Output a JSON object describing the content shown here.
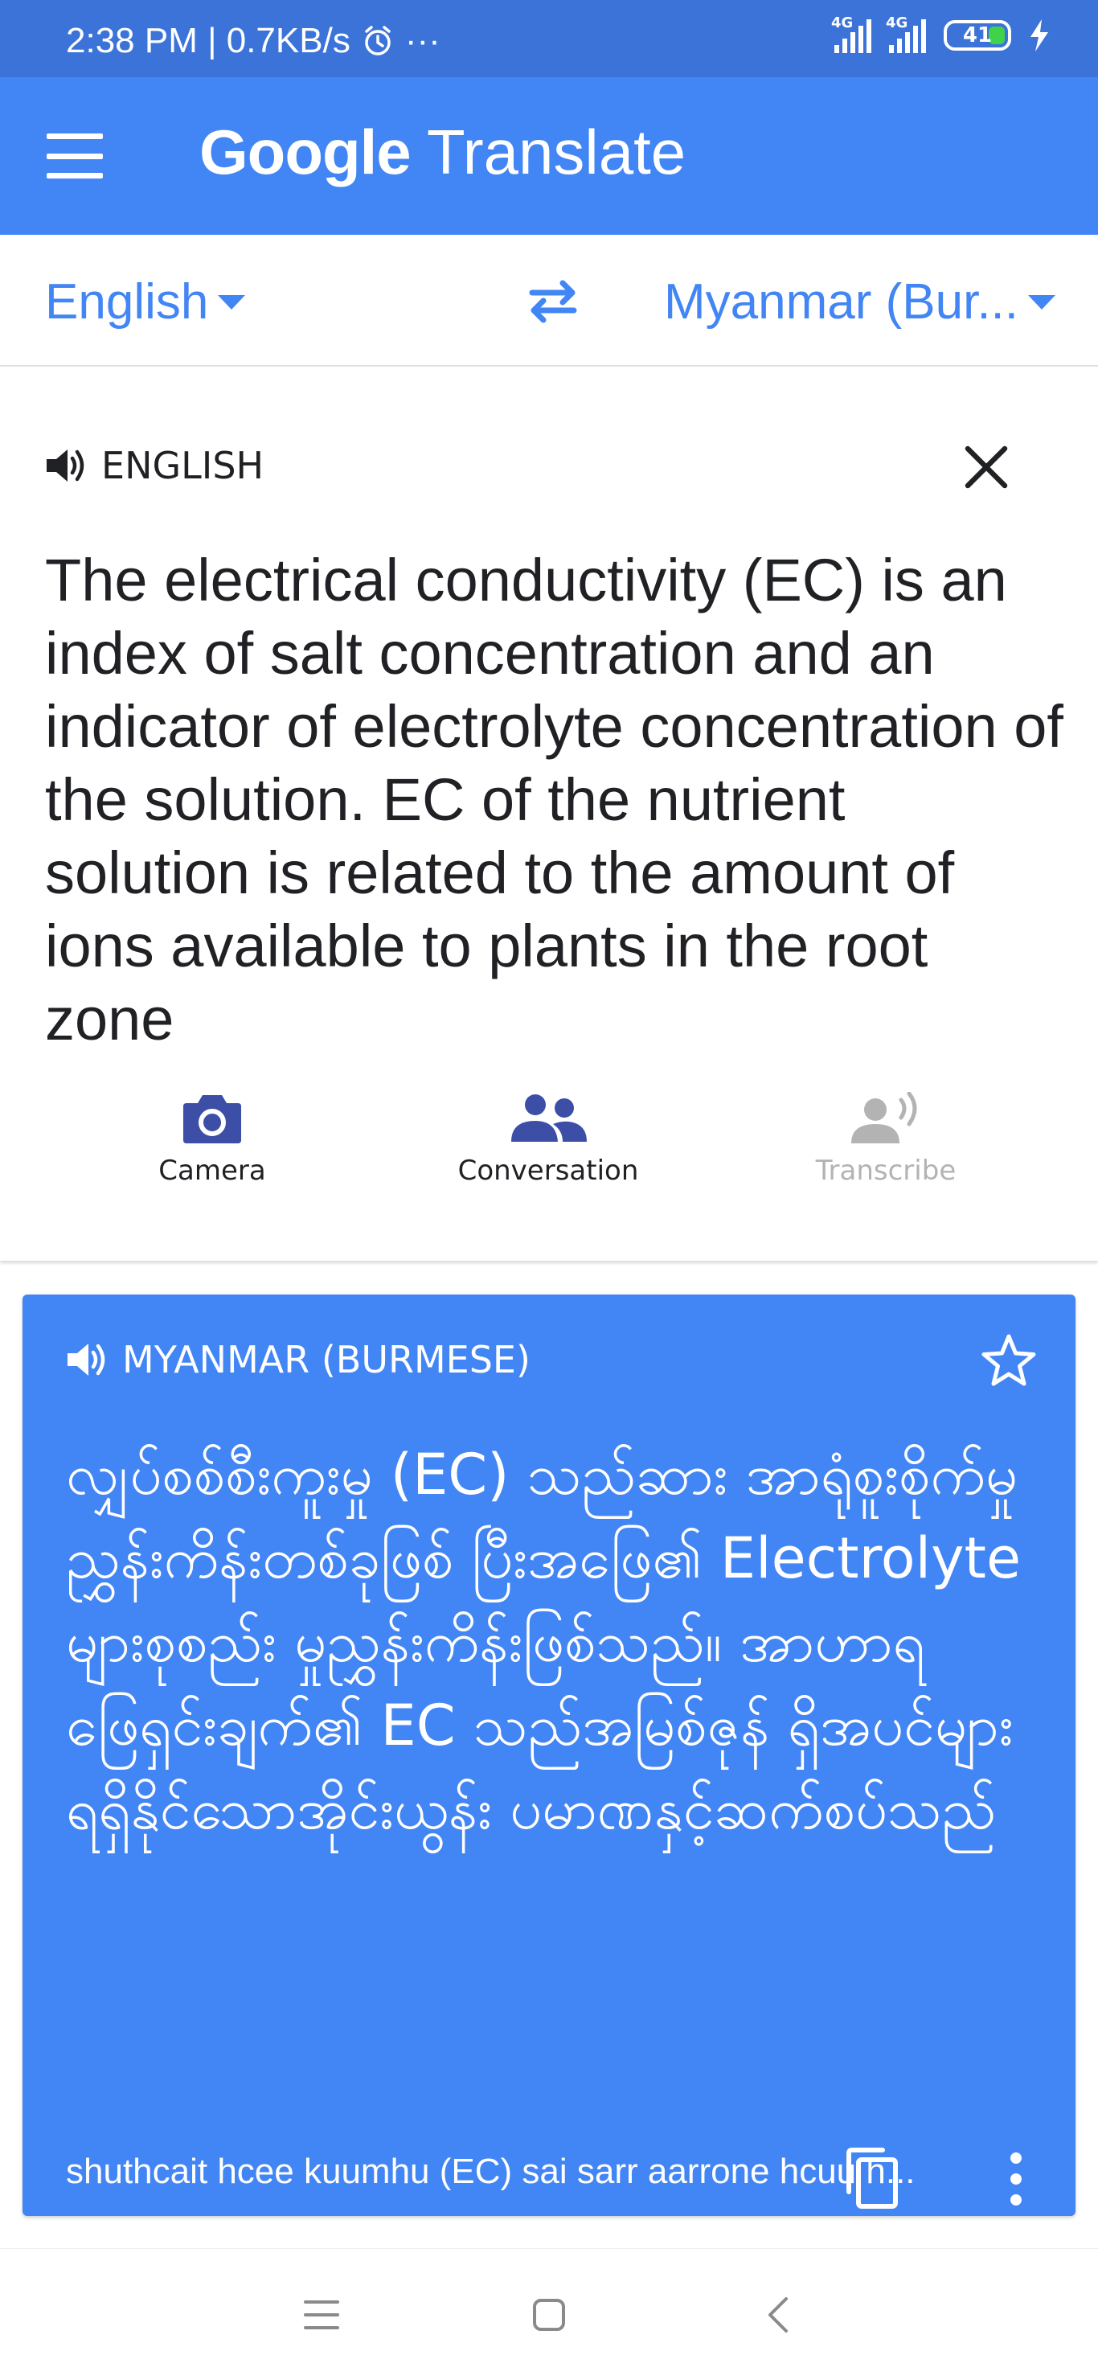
{
  "status_bar": {
    "time_speed": "2:38 PM | 0.7KB/s",
    "more": "···",
    "net1": "4G",
    "net2": "4G",
    "battery": "41"
  },
  "app_bar": {
    "title_brand": "Google",
    "title_product": "Translate"
  },
  "languages": {
    "source": "English",
    "target": "Myanmar (Bur..."
  },
  "input": {
    "label": "ENGLISH",
    "text": "The electrical conductivity (EC) is an index of salt concentration and an indicator of electrolyte concentration of the solution. EC of the nutrient solution is related to the amount of ions available to plants in the root zone"
  },
  "tools": [
    {
      "label": "Camera"
    },
    {
      "label": "Conversation"
    },
    {
      "label": "Transcribe"
    }
  ],
  "result": {
    "label": "MYANMAR (BURMESE)",
    "text": "လျှပ်စစ်စီးကူးမှု (EC) သည်ဆား အာရုံစူးစိုက်မှုညွှန်းကိန်းတစ်ခုဖြစ် ပြီးအဖြေ၏ Electrolyte များစုစည်း မှုညွှန်းကိန်းဖြစ်သည်။ အာဟာရ ဖြေရှင်းချက်၏ EC သည်အမြစ်ဇုန် ရှိအပင်များရရှိနိုင်သောအိုင်းယွန်း ပမာဏနှင့်ဆက်စပ်သည်",
    "transliteration": "shuthcait hcee kuumhu (EC)  sai sarr aarrone hcuu h..."
  },
  "colors": {
    "status_bar": "#3b73d9",
    "primary": "#4285f4",
    "text": "#202124",
    "disabled": "#b3b3b3",
    "tool_icon": "#3c4ea6"
  }
}
